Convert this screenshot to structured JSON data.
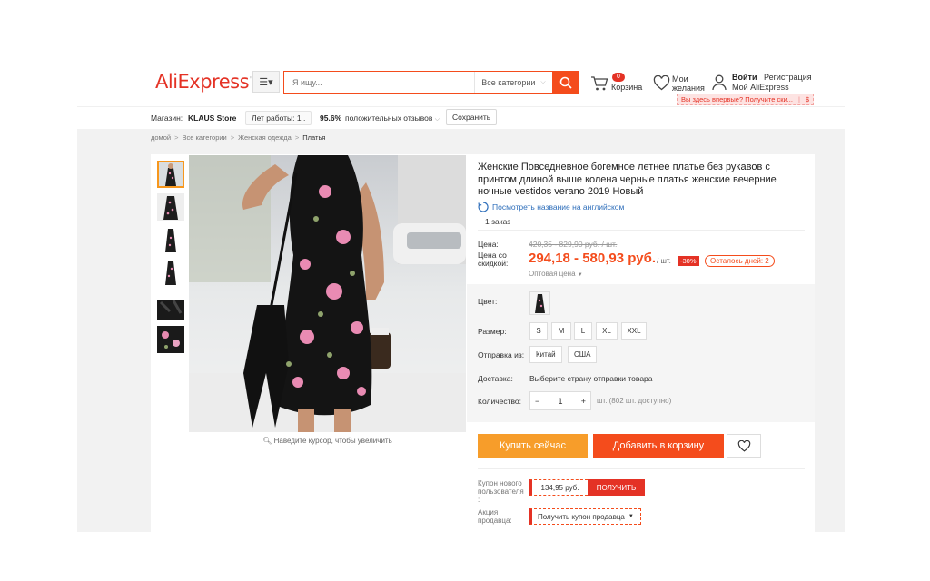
{
  "header": {
    "logo_text": "AliExpress",
    "search_placeholder": "Я ищу...",
    "search_category": "Все категории",
    "cart_count": "0",
    "cart_label": "Корзина",
    "wishlist_line1": "Мои",
    "wishlist_line2": "желания",
    "signin_label": "Войти",
    "register_label": "Регистрация",
    "my_account_label": "Мой AliExpress",
    "promo_text": "Вы здесь впервые? Получите ски...",
    "promo_currency": "$"
  },
  "store": {
    "label": "Магазин:",
    "name": "KLAUS Store",
    "years": "Лет работы: 1 .",
    "rating": "95.6%",
    "rating_label": "положительных отзывов",
    "save_label": "Сохранить"
  },
  "breadcrumb": [
    "домой",
    "Все категории",
    "Женская одежда",
    "Платья"
  ],
  "gallery": {
    "zoom_hint": "Наведите курсор, чтобы увеличить"
  },
  "product": {
    "title": "Женские Повседневное богемное летнее платье без рукавов с принтом длиной выше колена черные платья женские вечерние ночные vestidos verano 2019 Новый",
    "translate_link": "Посмотреть название на английском",
    "orders": "1 заказ",
    "price_label": "Цена:",
    "old_price": "420,35 - 829,90 руб. / шт.",
    "discount_price_label": "Цена со скидкой:",
    "new_price": "294,18 - 580,93 руб.",
    "per_unit": "/ шт.",
    "discount": "-30%",
    "days_left": "Осталось дней: 2",
    "wholesale": "Оптовая цена",
    "color_label": "Цвет:",
    "size_label": "Размер:",
    "sizes": [
      "S",
      "M",
      "L",
      "XL",
      "XXL"
    ],
    "ship_from_label": "Отправка из:",
    "ship_from": [
      "Китай",
      "США"
    ],
    "delivery_label": "Доставка:",
    "delivery_value": "Выберите страну отправки товара",
    "quantity_label": "Количество:",
    "quantity": "1",
    "quantity_minus": "−",
    "quantity_plus": "+",
    "quantity_note": "шт. (802 шт. доступно)",
    "buy_now": "Купить сейчас",
    "add_to_cart": "Добавить в корзину",
    "new_user_coupon_label": "Купон нового пользователя :",
    "coupon_amount": "134,95 руб.",
    "coupon_get": "ПОЛУЧИТЬ",
    "seller_promo_label": "Акция продавца:",
    "seller_coupon": "Получить купон продавца"
  },
  "colors": {
    "brand_red": "#e43225",
    "brand_orange": "#f7971d",
    "buy_orange": "#f79d2a",
    "cart_red": "#f44c1c"
  }
}
